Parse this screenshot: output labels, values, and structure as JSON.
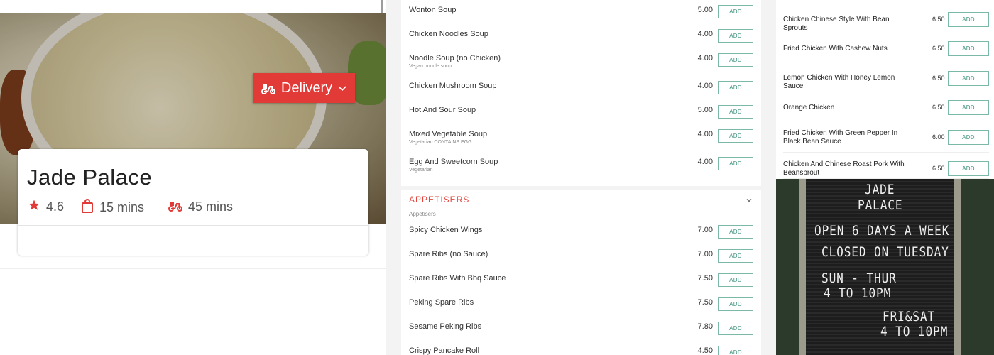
{
  "restaurant": {
    "name": "Jade Palace",
    "rating": "4.6",
    "prep_time": "15 mins",
    "delivery_time": "45 mins"
  },
  "delivery_button": {
    "label": "Delivery"
  },
  "colors": {
    "accent": "#e23a36",
    "add_border": "#7ab8a8",
    "add_text": "#3a8f7a",
    "section_title": "#e2463d"
  },
  "icons": {
    "rating": "star-icon",
    "prep": "shopping-bag-icon",
    "delivery": "scooter-icon",
    "dropdown": "chevron-down-icon"
  },
  "add_label": "ADD",
  "soups": [
    {
      "name": "Wonton Soup",
      "price": "5.00",
      "sub": ""
    },
    {
      "name": "Chicken Noodles Soup",
      "price": "4.00",
      "sub": ""
    },
    {
      "name": "Noodle Soup (no Chicken)",
      "price": "4.00",
      "sub": "Vegan noodle soup"
    },
    {
      "name": "Chicken Mushroom Soup",
      "price": "4.00",
      "sub": ""
    },
    {
      "name": "Hot And Sour Soup",
      "price": "5.00",
      "sub": ""
    },
    {
      "name": "Mixed Vegetable Soup",
      "price": "4.00",
      "sub": "Vegetarian CONTAINS EGG"
    },
    {
      "name": "Egg And Sweetcorn Soup",
      "price": "4.00",
      "sub": "Vegetarian"
    }
  ],
  "appetisers_section": {
    "title": "APPETISERS",
    "subtitle": "Appetisers"
  },
  "appetisers": [
    {
      "name": "Spicy Chicken Wings",
      "price": "7.00"
    },
    {
      "name": "Spare Ribs (no Sauce)",
      "price": "7.00"
    },
    {
      "name": "Spare Ribs With Bbq Sauce",
      "price": "7.50"
    },
    {
      "name": "Peking Spare Ribs",
      "price": "7.50"
    },
    {
      "name": "Sesame Peking Ribs",
      "price": "7.80"
    },
    {
      "name": "Crispy Pancake Roll",
      "price": "4.50"
    }
  ],
  "chicken_dishes": [
    {
      "name": "Chicken Chinese Style With Bean Sprouts",
      "price": "6.50"
    },
    {
      "name": "Fried Chicken With Cashew Nuts",
      "price": "6.50"
    },
    {
      "name": "Lemon Chicken With Honey Lemon Sauce",
      "price": "6.50"
    },
    {
      "name": "Orange Chicken",
      "price": "6.50"
    },
    {
      "name": "Fried Chicken With Green Pepper In Black Bean Sauce",
      "price": "6.00"
    },
    {
      "name": "Chicken And Chinese Roast Pork With Beansprout",
      "price": "6.50"
    }
  ],
  "sign": {
    "lines": [
      "JADE",
      "PALACE",
      "OPEN 6 DAYS A WEEK",
      "CLOSED ON TUESDAY",
      "SUN - THUR",
      "4 TO 10PM",
      "FRI&SAT",
      "4 TO 10PM"
    ]
  }
}
